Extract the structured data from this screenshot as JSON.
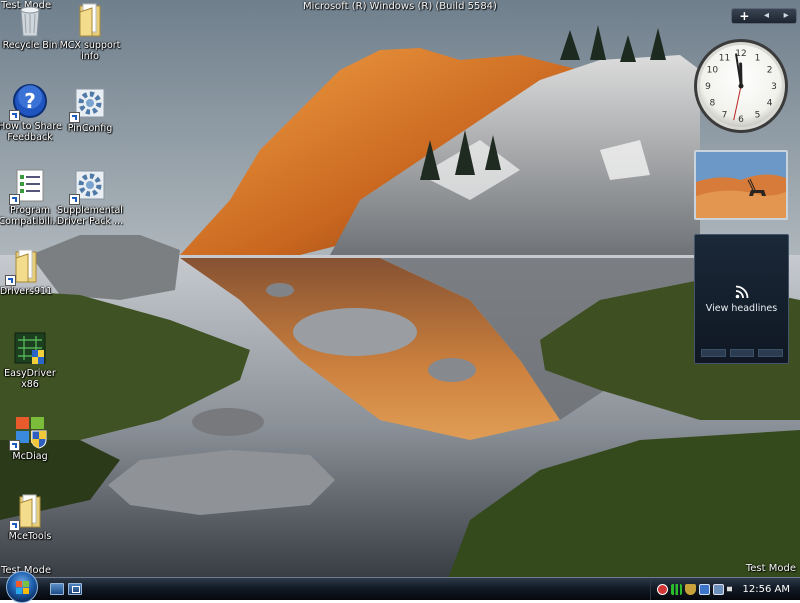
{
  "watermark": {
    "top_left": "Test Mode",
    "title": "Microsoft (R) Windows (R) (Build 5584)",
    "bottom_right": "Test Mode",
    "bottom_left": "Test Mode"
  },
  "desktop_icons": [
    {
      "label": "Recycle Bin",
      "icon": "recycle-bin-icon"
    },
    {
      "label": "MCX support info",
      "icon": "folder-icon"
    },
    {
      "label": "How to Share Feedback",
      "icon": "help-icon"
    },
    {
      "label": "PinConfig",
      "icon": "gear-icon"
    },
    {
      "label": "Program Compatibili...",
      "icon": "checklist-icon"
    },
    {
      "label": "Supplemental Driver Pack ...",
      "icon": "gear-icon"
    },
    {
      "label": "Drivers911",
      "icon": "folder-icon"
    },
    {
      "label": "EasyDriver x86",
      "icon": "circuit-icon"
    },
    {
      "label": "McDiag",
      "icon": "windows-shield-icon"
    },
    {
      "label": "MceTools",
      "icon": "folder-icon"
    }
  ],
  "sidebar": {
    "add_label": "+",
    "prev_label": "◂",
    "next_label": "▸",
    "clock": {
      "hour": 11,
      "minute": 58,
      "second": 32
    },
    "feed": {
      "label": "View headlines"
    }
  },
  "taskbar": {
    "clock": "12:56 AM"
  },
  "colors": {
    "taskbar": "#0b1119",
    "sidebar_gadget": "#152232",
    "sky_top": "#a9b4bf",
    "mountain_glow": "#e58a2c"
  }
}
